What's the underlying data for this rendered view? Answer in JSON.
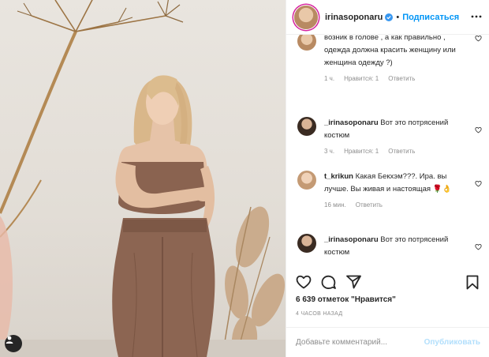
{
  "header": {
    "username": "irinasoponaru",
    "dot": "•",
    "follow_label": "Подписаться"
  },
  "comments": [
    {
      "username": "",
      "text": "возник в голове , а как правильно , одежда должна красить женщину или женщина одежду ?)",
      "time": "1 ч.",
      "likes": "Нравится: 1",
      "reply": "Ответить"
    },
    {
      "username": "_irinasoponaru",
      "text": "Вот это потрясений костюм",
      "time": "3 ч.",
      "likes": "Нравится: 1",
      "reply": "Ответить"
    },
    {
      "username": "t_krikun",
      "text": "Какая Бекхэм???. Ира. вы лучше. Вы живая и настоящая 🌹👌",
      "time": "16 мин.",
      "reply": "Ответить"
    },
    {
      "username": "_irinasoponaru",
      "text": "Вот это потрясений костюм"
    }
  ],
  "likes_line": "6 639 отметок \"Нравится\"",
  "timestamp": "4 ЧАСОВ НАЗАД",
  "add_comment": {
    "placeholder": "Добавьте комментарий...",
    "publish_label": "Опубликовать"
  },
  "colors": {
    "accent": "#0095f6",
    "publish_disabled": "#b2dffc",
    "meta": "#8e8e8e",
    "text": "#262626"
  },
  "icons": {
    "header_more": "more-horizontal-icon",
    "verified": "verified-badge-icon",
    "heart": "heart-icon",
    "comment": "comment-icon",
    "share": "share-icon",
    "save": "bookmark-icon",
    "tag": "user-tag-icon"
  }
}
